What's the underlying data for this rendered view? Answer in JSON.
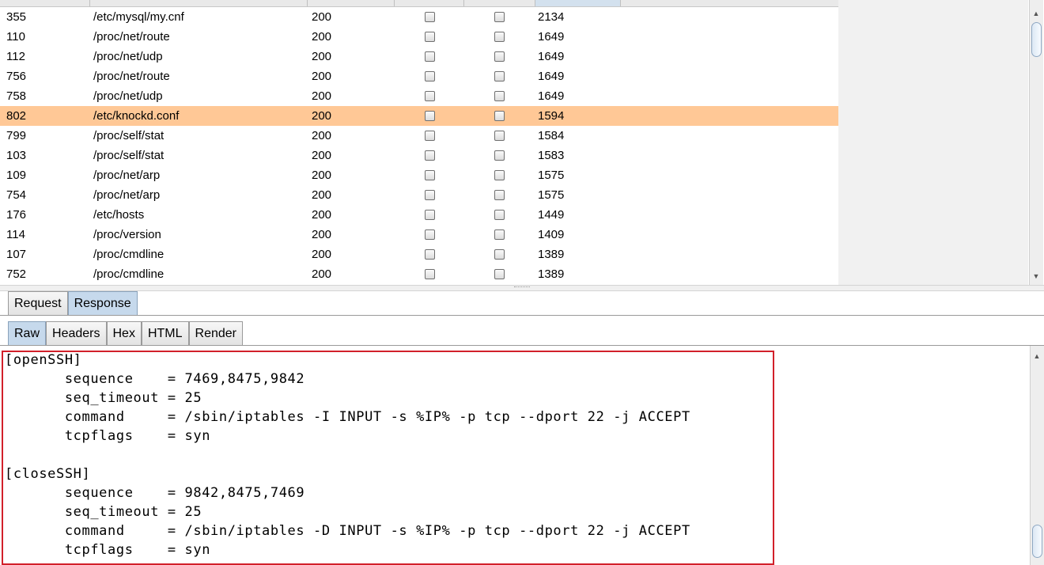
{
  "results": {
    "rows": [
      {
        "id": "355",
        "path": "/etc/mysql/my.cnf",
        "status": "200",
        "length": "2134",
        "selected": false
      },
      {
        "id": "110",
        "path": "/proc/net/route",
        "status": "200",
        "length": "1649",
        "selected": false
      },
      {
        "id": "112",
        "path": "/proc/net/udp",
        "status": "200",
        "length": "1649",
        "selected": false
      },
      {
        "id": "756",
        "path": "/proc/net/route",
        "status": "200",
        "length": "1649",
        "selected": false
      },
      {
        "id": "758",
        "path": "/proc/net/udp",
        "status": "200",
        "length": "1649",
        "selected": false
      },
      {
        "id": "802",
        "path": "/etc/knockd.conf",
        "status": "200",
        "length": "1594",
        "selected": true
      },
      {
        "id": "799",
        "path": "/proc/self/stat",
        "status": "200",
        "length": "1584",
        "selected": false
      },
      {
        "id": "103",
        "path": "/proc/self/stat",
        "status": "200",
        "length": "1583",
        "selected": false
      },
      {
        "id": "109",
        "path": "/proc/net/arp",
        "status": "200",
        "length": "1575",
        "selected": false
      },
      {
        "id": "754",
        "path": "/proc/net/arp",
        "status": "200",
        "length": "1575",
        "selected": false
      },
      {
        "id": "176",
        "path": "/etc/hosts",
        "status": "200",
        "length": "1449",
        "selected": false
      },
      {
        "id": "114",
        "path": "/proc/version",
        "status": "200",
        "length": "1409",
        "selected": false
      },
      {
        "id": "107",
        "path": "/proc/cmdline",
        "status": "200",
        "length": "1389",
        "selected": false
      },
      {
        "id": "752",
        "path": "/proc/cmdline",
        "status": "200",
        "length": "1389",
        "selected": false
      }
    ]
  },
  "message_tabs": [
    {
      "label": "Request",
      "active": false
    },
    {
      "label": "Response",
      "active": true
    }
  ],
  "view_tabs": [
    {
      "label": "Raw",
      "active": true
    },
    {
      "label": "Headers",
      "active": false
    },
    {
      "label": "Hex",
      "active": false
    },
    {
      "label": "HTML",
      "active": false
    },
    {
      "label": "Render",
      "active": false
    }
  ],
  "response_body": {
    "lines": [
      "[openSSH]",
      "       sequence    = 7469,8475,9842",
      "       seq_timeout = 25",
      "       command     = /sbin/iptables -I INPUT -s %IP% -p tcp --dport 22 -j ACCEPT",
      "       tcpflags    = syn",
      "",
      "[closeSSH]",
      "       sequence    = 9842,8475,7469",
      "       seq_timeout = 25",
      "       command     = /sbin/iptables -D INPUT -s %IP% -p tcp --dport 22 -j ACCEPT",
      "       tcpflags    = syn"
    ]
  },
  "colors": {
    "selected_row": "#ffc896",
    "highlight_border": "#d2202a",
    "active_tab": "#c6d9ec"
  }
}
